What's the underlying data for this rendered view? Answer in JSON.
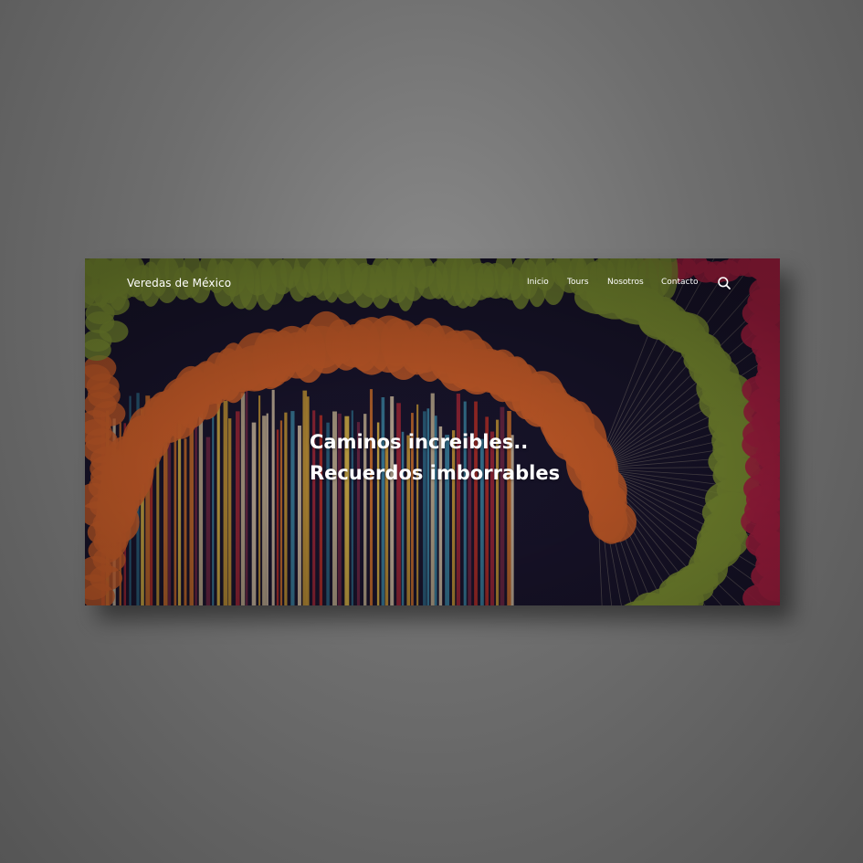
{
  "site": {
    "brand": "Veredas de México",
    "nav": [
      {
        "label": "Inicio"
      },
      {
        "label": "Tours"
      },
      {
        "label": "Nosotros"
      },
      {
        "label": "Contacto"
      }
    ],
    "search_icon": "search-icon"
  },
  "hero": {
    "line1": "Caminos increibles..",
    "line2": "Recuerdos imborrables",
    "image": "colorful papel picado tunnel",
    "colors": {
      "orange": "#e2692e",
      "green": "#8ea53a",
      "magenta": "#c4234c",
      "navy": "#1b1630"
    }
  }
}
